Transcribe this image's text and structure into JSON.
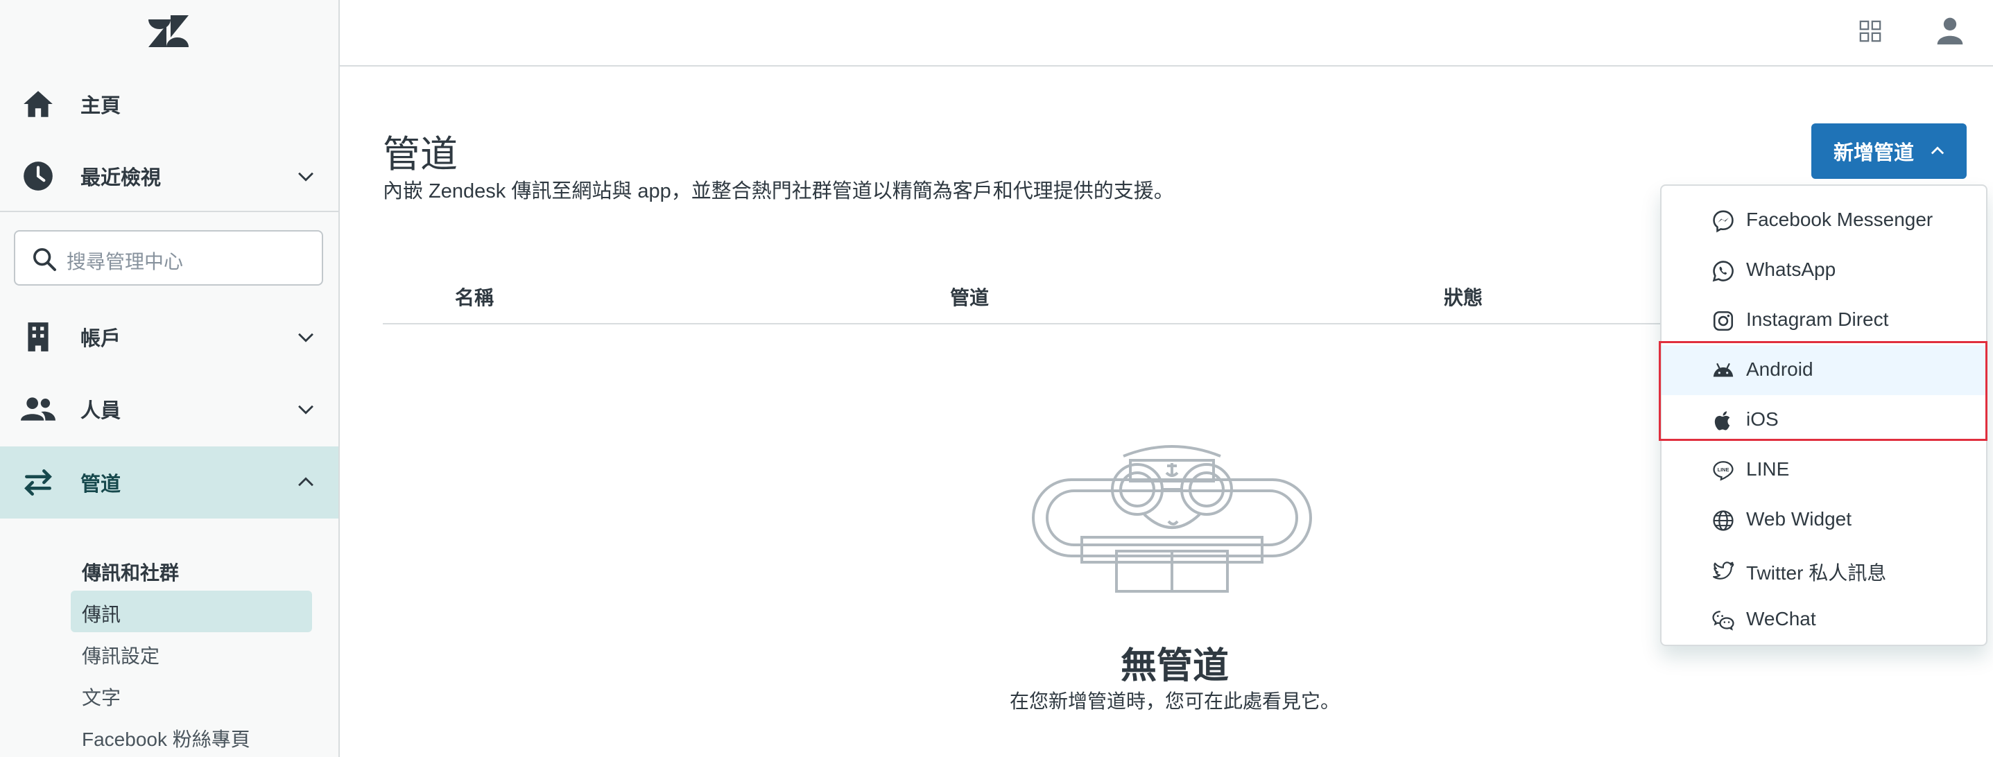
{
  "sidebar": {
    "nav": {
      "home": "主頁",
      "recent": "最近檢視",
      "account": "帳戶",
      "people": "人員",
      "channels": "管道"
    },
    "search_placeholder": "搜尋管理中心",
    "channels_sub": {
      "section_title": "傳訊和社群",
      "items": [
        "傳訊",
        "傳訊設定",
        "文字",
        "Facebook 粉絲專頁"
      ]
    }
  },
  "main": {
    "title": "管道",
    "description": "內嵌 Zendesk 傳訊至網站與 app，並整合熱門社群管道以精簡為客戶和代理提供的支援。",
    "add_button": "新增管道",
    "table_headers": [
      "名稱",
      "管道",
      "狀態"
    ],
    "empty_title": "無管道",
    "empty_desc": "在您新增管道時，您可在此處看見它。"
  },
  "dropdown": {
    "items": [
      {
        "label": "Facebook Messenger",
        "icon": "messenger-icon"
      },
      {
        "label": "WhatsApp",
        "icon": "whatsapp-icon"
      },
      {
        "label": "Instagram Direct",
        "icon": "instagram-icon"
      },
      {
        "label": "Android",
        "icon": "android-icon"
      },
      {
        "label": "iOS",
        "icon": "apple-icon"
      },
      {
        "label": "LINE",
        "icon": "line-icon"
      },
      {
        "label": "Web Widget",
        "icon": "globe-icon"
      },
      {
        "label": "Twitter 私人訊息",
        "icon": "twitter-icon"
      },
      {
        "label": "WeChat",
        "icon": "wechat-icon"
      }
    ]
  },
  "colors": {
    "accent": "#1f73b7",
    "active_nav": "#d1e8e8",
    "highlight_box": "#e02f3e"
  }
}
